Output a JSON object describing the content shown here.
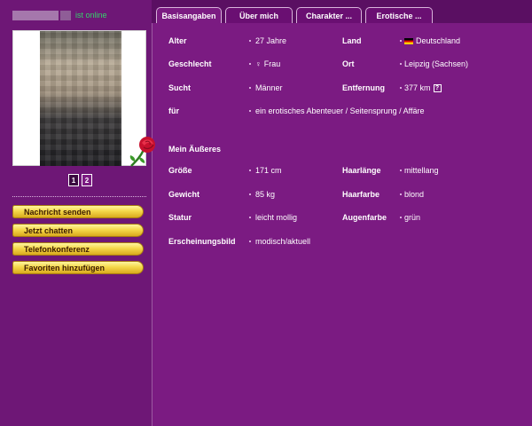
{
  "status": {
    "online_label": "ist online"
  },
  "tabs": [
    {
      "label": "Basisangaben",
      "active": true
    },
    {
      "label": "Über mich",
      "active": false
    },
    {
      "label": "Charakter ...",
      "active": false
    },
    {
      "label": "Erotische ...",
      "active": false
    }
  ],
  "gallery": {
    "pages": [
      "1",
      "2"
    ],
    "current_page": "1"
  },
  "actions": [
    "Nachricht senden",
    "Jetzt chatten",
    "Telefonkonferenz",
    "Favoriten hinzufügen"
  ],
  "basics": {
    "alter_label": "Alter",
    "alter_value": "27 Jahre",
    "land_label": "Land",
    "land_value": "Deutschland",
    "geschlecht_label": "Geschlecht",
    "geschlecht_value": "Frau",
    "geschlecht_symbol": "♀",
    "ort_label": "Ort",
    "ort_value": "Leipzig (Sachsen)",
    "sucht_label": "Sucht",
    "sucht_value": "Männer",
    "entfernung_label": "Entfernung",
    "entfernung_value": "377 km",
    "entfernung_help": "?",
    "fuer_label": "für",
    "fuer_value": "ein erotisches Abenteuer / Seitensprung / Affäre"
  },
  "appearance": {
    "section_title": "Mein Äußeres",
    "groesse_label": "Größe",
    "groesse_value": "171 cm",
    "haarlaenge_label": "Haarlänge",
    "haarlaenge_value": "mittellang",
    "gewicht_label": "Gewicht",
    "gewicht_value": "85 kg",
    "haarfarbe_label": "Haarfarbe",
    "haarfarbe_value": "blond",
    "statur_label": "Statur",
    "statur_value": "leicht mollig",
    "augenfarbe_label": "Augenfarbe",
    "augenfarbe_value": "grün",
    "erscheinung_label": "Erscheinungsbild",
    "erscheinung_value": "modisch/aktuell"
  },
  "colors": {
    "background": "#7b1b82",
    "sidebar": "#6e1776",
    "online_green": "#36d36b",
    "button_gold": "#f5d84a"
  }
}
